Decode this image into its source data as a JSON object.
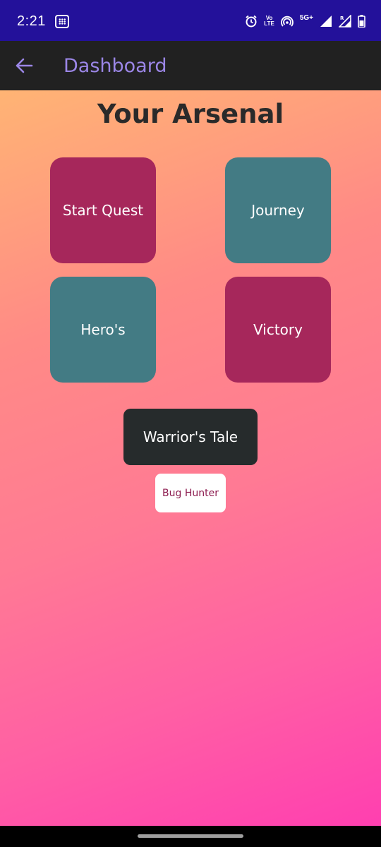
{
  "status_bar": {
    "time": "2:21",
    "network": "5G+",
    "icons": [
      "app-notification-icon",
      "alarm-icon",
      "volte-icon",
      "hotspot-icon",
      "signal-icon",
      "signal-roaming-icon",
      "battery-icon"
    ],
    "volte_line1": "Vo",
    "volte_line2": "LTE"
  },
  "app_bar": {
    "title": "Dashboard",
    "back_icon": "arrow-left-icon",
    "accent_color": "#9b86e6"
  },
  "main": {
    "title": "Your Arsenal",
    "tiles": [
      {
        "label": "Start Quest",
        "color": "#a6275b"
      },
      {
        "label": "Journey",
        "color": "#437b84"
      },
      {
        "label": "Hero's",
        "color": "#437b84"
      },
      {
        "label": "Victory",
        "color": "#a6275b"
      }
    ],
    "primary_button": {
      "label": "Warrior's Tale",
      "color": "#262b2c",
      "text_color": "#ffffff"
    },
    "secondary_button": {
      "label": "Bug Hunter",
      "color": "#ffffff",
      "text_color": "#8c1b4f"
    }
  }
}
